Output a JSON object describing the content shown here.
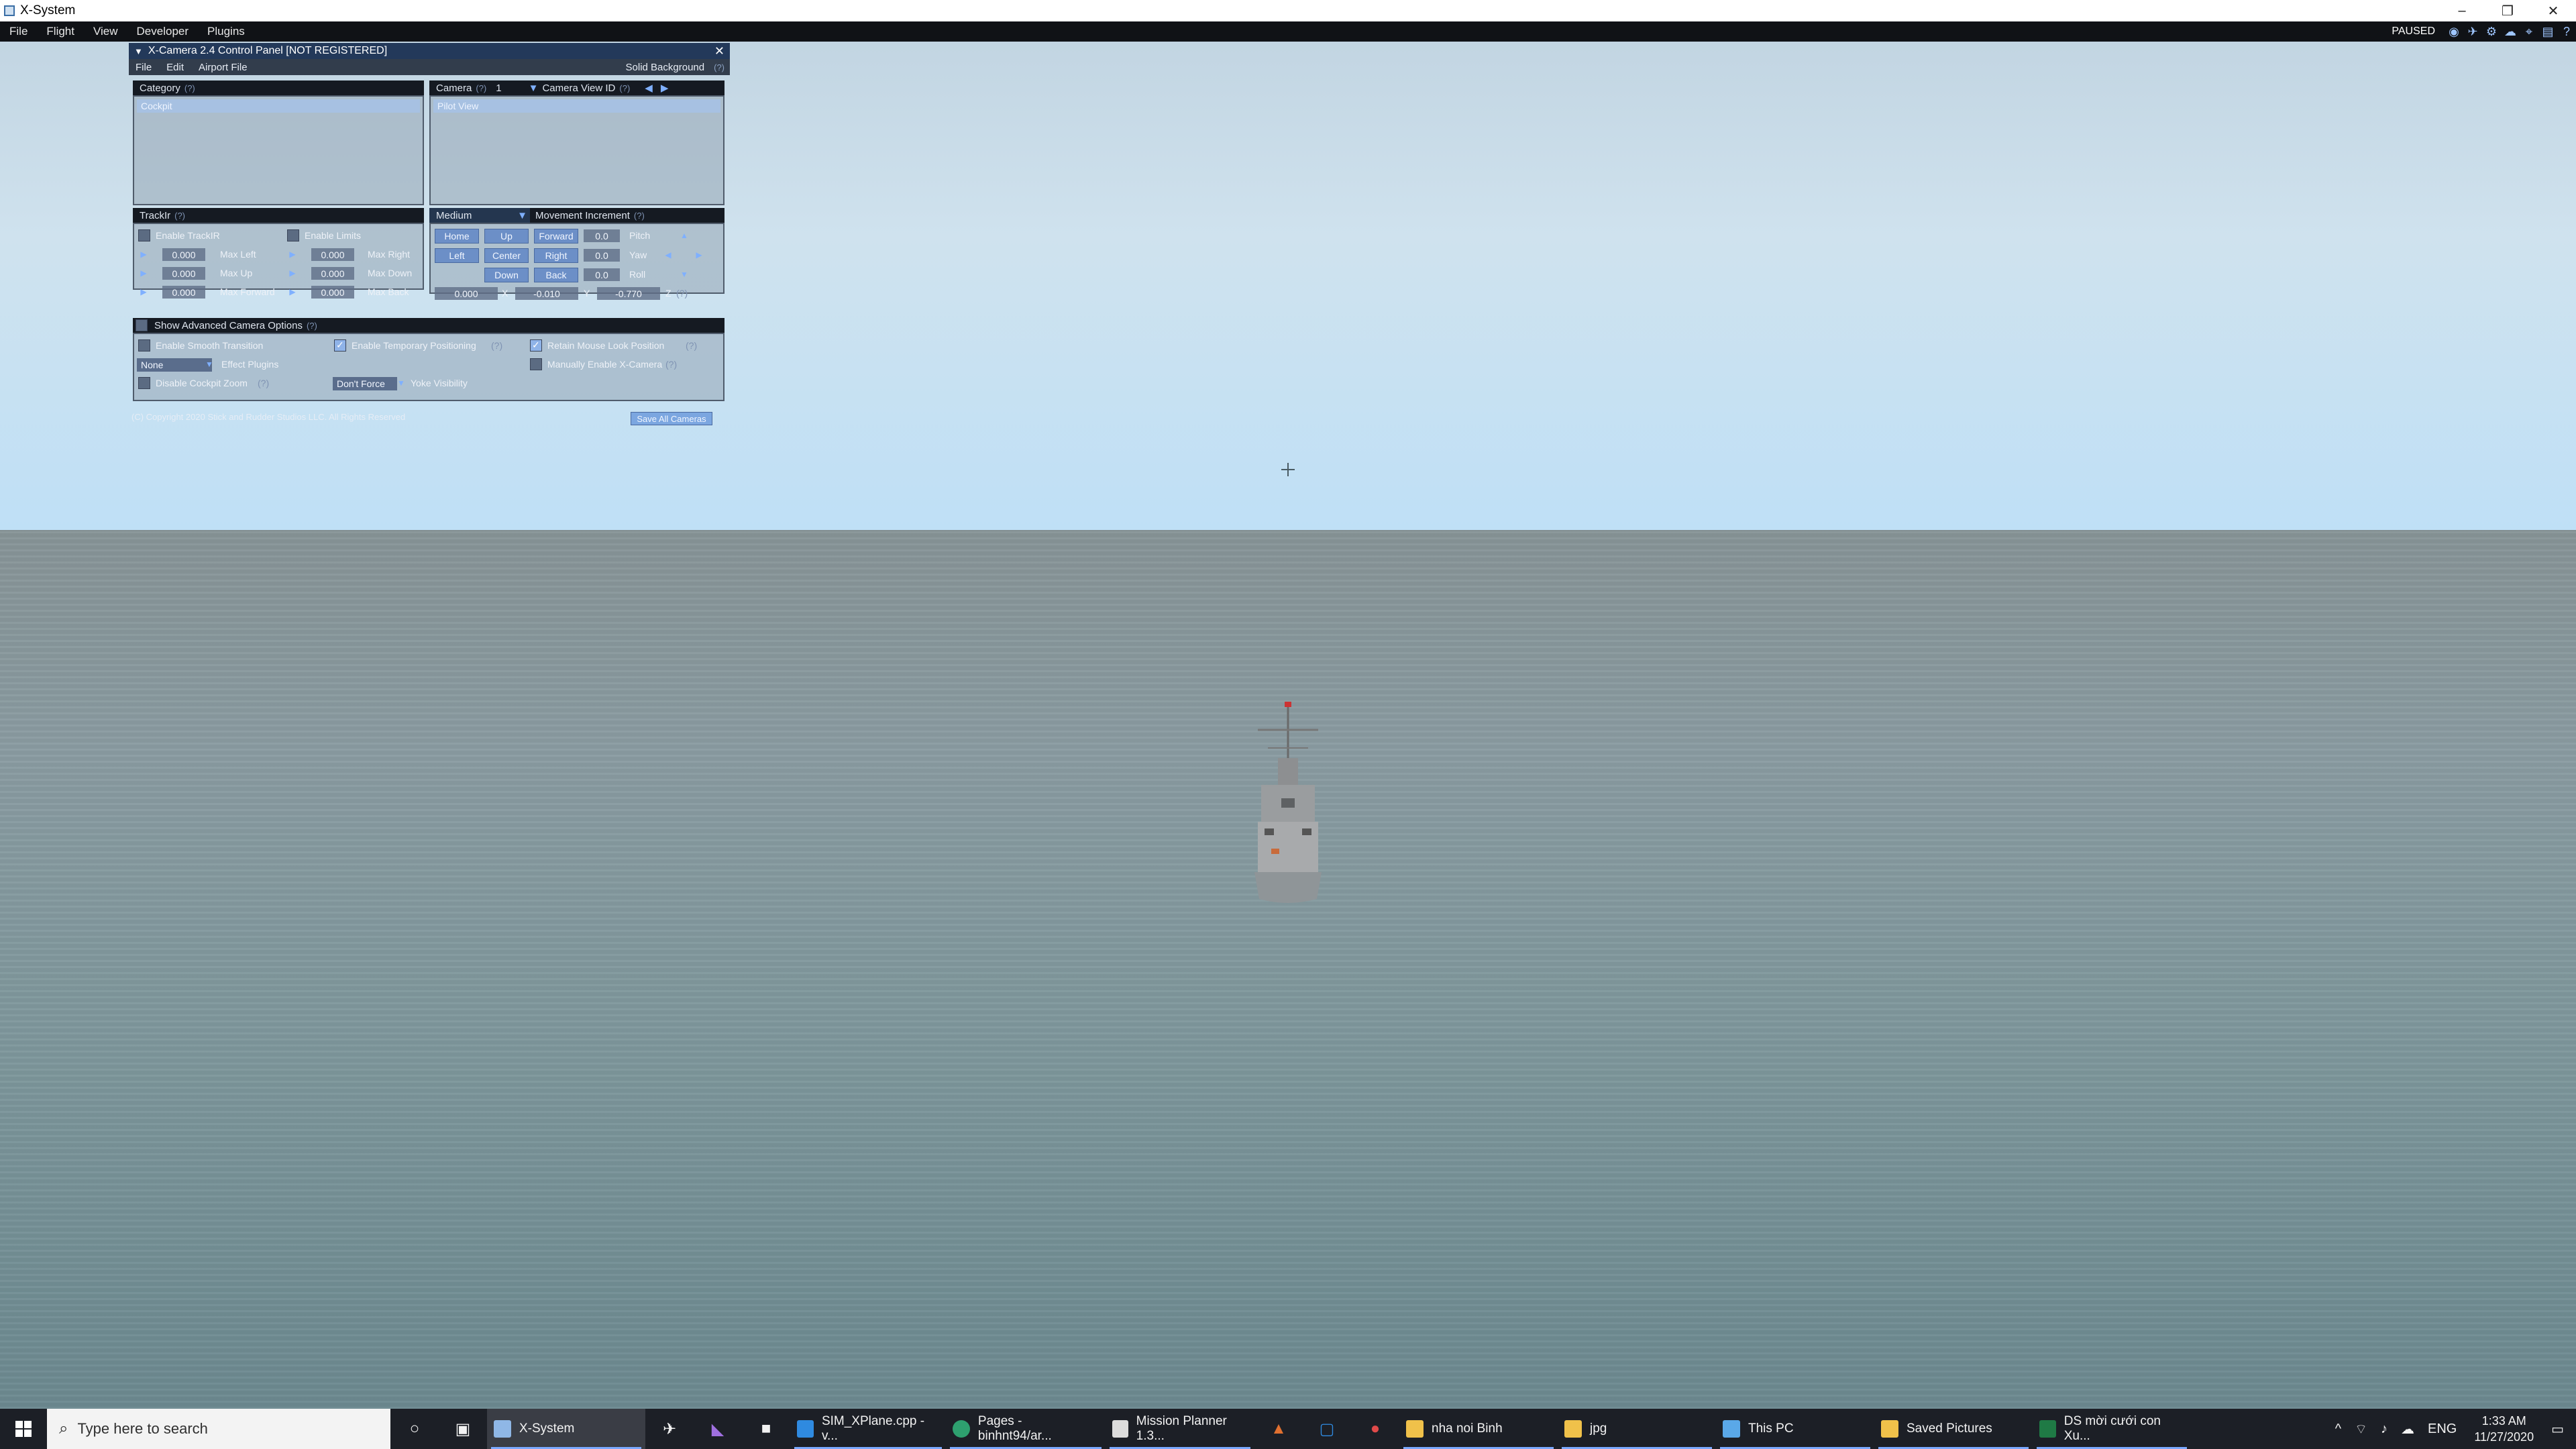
{
  "window": {
    "title": "X-System"
  },
  "xp_menu": {
    "items": [
      "File",
      "Flight",
      "View",
      "Developer",
      "Plugins"
    ],
    "status": "PAUSED"
  },
  "xcamera": {
    "title": "X-Camera 2.4 Control Panel   [NOT REGISTERED]",
    "menu": [
      "File",
      "Edit",
      "Airport File"
    ],
    "solid_background": "Solid Background",
    "q": "(?)",
    "category": {
      "header": "Category",
      "selected": "Cockpit"
    },
    "camera": {
      "header": "Camera",
      "number": "1",
      "view_id_label": "Camera View ID",
      "selected": "Pilot View"
    },
    "trackir": {
      "header": "TrackIr",
      "enable_trackir": "Enable TrackIR",
      "enable_limits": "Enable Limits",
      "rows": [
        {
          "v1": "0.000",
          "l1": "Max Left",
          "v2": "0.000",
          "l2": "Max Right"
        },
        {
          "v1": "0.000",
          "l1": "Max Up",
          "v2": "0.000",
          "l2": "Max Down"
        },
        {
          "v1": "0.000",
          "l1": "Max Forward",
          "v2": "0.000",
          "l2": "Max Back"
        }
      ]
    },
    "movement": {
      "speed": "Medium",
      "label": "Movement Increment",
      "home": "Home",
      "up": "Up",
      "forward": "Forward",
      "left": "Left",
      "center": "Center",
      "right": "Right",
      "down": "Down",
      "back": "Back",
      "pitch_val": "0.0",
      "pitch": "Pitch",
      "yaw_val": "0.0",
      "yaw": "Yaw",
      "roll_val": "0.0",
      "roll": "Roll",
      "x_val": "0.000",
      "x": "X",
      "y_val": "-0.010",
      "y": "Y",
      "z_val": "-0.770",
      "z": "Z"
    },
    "advanced": {
      "header": "Show Advanced Camera Options",
      "smooth": "Enable Smooth Transition",
      "temp_pos": "Enable Temporary Positioning",
      "retain_mouse": "Retain Mouse Look Position",
      "effect_select": "None",
      "effect_plugins": "Effect Plugins",
      "manual_enable": "Manually Enable X-Camera",
      "disable_zoom": "Disable Cockpit Zoom",
      "yoke_select": "Don't Force",
      "yoke_visibility": "Yoke Visibility"
    },
    "copyright": "(C) Copyright 2020 Stick and Rudder Studios LLC. All Rights Reserved",
    "save_all": "Save All Cameras"
  },
  "taskbar": {
    "search_placeholder": "Type here to search",
    "apps": [
      "X-System",
      "SIM_XPlane.cpp - v...",
      "Pages - binhnt94/ar...",
      "Mission Planner 1.3...",
      "nha noi Binh",
      "jpg",
      "This PC",
      "Saved Pictures",
      "DS mời cưới con Xu..."
    ],
    "lang": "ENG",
    "time": "1:33 AM",
    "date": "11/27/2020"
  }
}
